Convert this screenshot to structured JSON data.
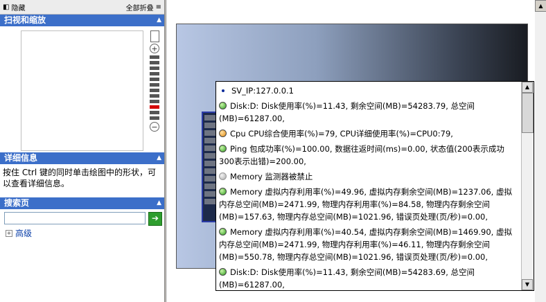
{
  "left_panel": {
    "hide_label": "隐藏",
    "collapse_all_label": "全部折叠",
    "scan_section_title": "扫视和缩放",
    "details_section_title": "详细信息",
    "details_text": "按住  Ctrl  键的同时单击绘图中的形状，可以查看详细信息。",
    "search_section_title": "搜索页",
    "search_value": "",
    "advanced_label": "高级"
  },
  "popup": {
    "entries": [
      {
        "status": "bullet",
        "text": "SV_IP:127.0.0.1"
      },
      {
        "status": "green",
        "text": "Disk:D: Disk使用率(%)=11.43, 剩余空间(MB)=54283.79, 总空间(MB)=61287.00,"
      },
      {
        "status": "orange",
        "text": "Cpu CPU综合使用率(%)=79, CPU详细使用率(%)=CPU0:79,"
      },
      {
        "status": "green",
        "text": "Ping 包成功率(%)=100.00, 数据往返时间(ms)=0.00, 状态值(200表示成功  300表示出错)=200.00,"
      },
      {
        "status": "gray",
        "text": "Memory 监测器被禁止"
      },
      {
        "status": "green",
        "text": "Memory 虚拟内存利用率(%)=49.96, 虚拟内存剩余空间(MB)=1237.06, 虚拟内存总空间(MB)=2471.99, 物理内存利用率(%)=84.58, 物理内存剩余空间(MB)=157.63, 物理内存总空间(MB)=1021.96, 错误页处理(页/秒)=0.00,"
      },
      {
        "status": "green",
        "text": "Memory 虚拟内存利用率(%)=40.54, 虚拟内存剩余空间(MB)=1469.90, 虚拟内存总空间(MB)=2471.99, 物理内存利用率(%)=46.11, 物理内存剩余空间(MB)=550.78, 物理内存总空间(MB)=1021.96, 错误页处理(页/秒)=0.00,"
      },
      {
        "status": "green",
        "text": "Disk:D: Disk使用率(%)=11.43, 剩余空间(MB)=54283.69, 总空间(MB)=61287.00,"
      }
    ]
  },
  "colors": {
    "section_header": "#3c6fc9",
    "status_green": "#2e9d1f",
    "status_orange": "#e38a12",
    "status_gray": "#a8a8a8"
  }
}
